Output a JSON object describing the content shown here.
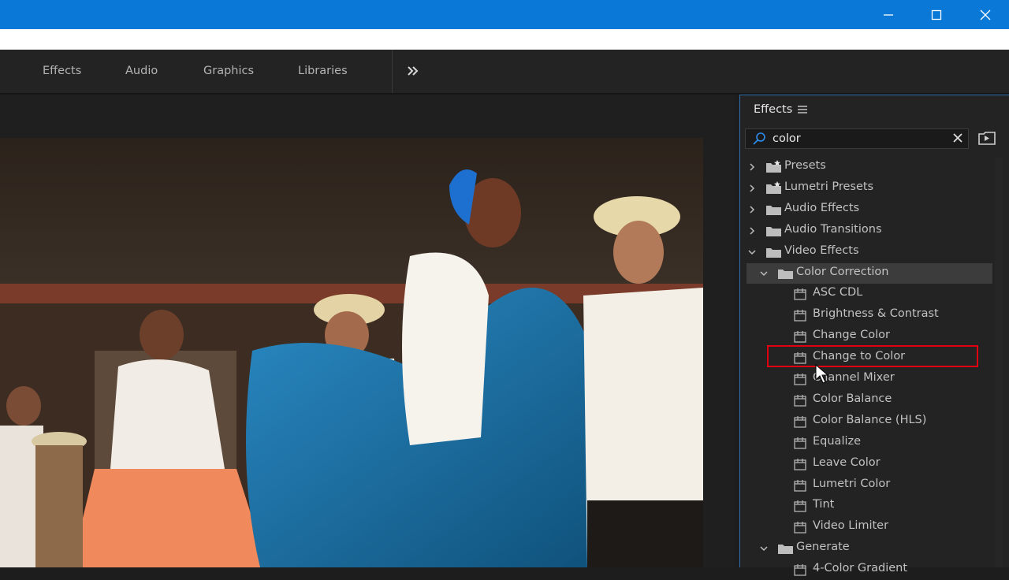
{
  "window": {
    "controls": [
      "minimize-icon",
      "maximize-icon",
      "close-icon"
    ]
  },
  "workspaces": {
    "tabs": [
      "Effects",
      "Audio",
      "Graphics",
      "Libraries"
    ],
    "more_icon": "double-chevron-right-icon"
  },
  "effects_panel": {
    "title": "Effects",
    "menu_icon": "hamburger-icon",
    "search": {
      "value": "color",
      "icon": "search-icon",
      "clear_icon": "close-icon"
    },
    "new_bin_icon": "new-custom-bin-icon",
    "tree": [
      {
        "label": "Presets",
        "kind": "preset-folder",
        "level": 0,
        "expanded": false
      },
      {
        "label": "Lumetri Presets",
        "kind": "preset-folder",
        "level": 0,
        "expanded": false
      },
      {
        "label": "Audio Effects",
        "kind": "folder",
        "level": 0,
        "expanded": false
      },
      {
        "label": "Audio Transitions",
        "kind": "folder",
        "level": 0,
        "expanded": false
      },
      {
        "label": "Video Effects",
        "kind": "folder",
        "level": 0,
        "expanded": true
      },
      {
        "label": "Color Correction",
        "kind": "folder",
        "level": 1,
        "expanded": true,
        "selected": true
      },
      {
        "label": "ASC CDL",
        "kind": "effect",
        "level": 2
      },
      {
        "label": "Brightness & Contrast",
        "kind": "effect",
        "level": 2
      },
      {
        "label": "Change Color",
        "kind": "effect",
        "level": 2
      },
      {
        "label": "Change to Color",
        "kind": "effect",
        "level": 2,
        "highlighted": true
      },
      {
        "label": "Channel Mixer",
        "kind": "effect",
        "level": 2
      },
      {
        "label": "Color Balance",
        "kind": "effect",
        "level": 2
      },
      {
        "label": "Color Balance (HLS)",
        "kind": "effect",
        "level": 2
      },
      {
        "label": "Equalize",
        "kind": "effect",
        "level": 2
      },
      {
        "label": "Leave Color",
        "kind": "effect",
        "level": 2
      },
      {
        "label": "Lumetri Color",
        "kind": "effect",
        "level": 2
      },
      {
        "label": "Tint",
        "kind": "effect",
        "level": 2
      },
      {
        "label": "Video Limiter",
        "kind": "effect",
        "level": 2
      },
      {
        "label": "Generate",
        "kind": "folder",
        "level": 1,
        "expanded": true
      },
      {
        "label": "4-Color Gradient",
        "kind": "effect",
        "level": 2
      }
    ]
  },
  "colors": {
    "titlebar": "#0a78d7",
    "highlight_box": "#e1000f",
    "panel_focus": "#2d6fb0"
  }
}
